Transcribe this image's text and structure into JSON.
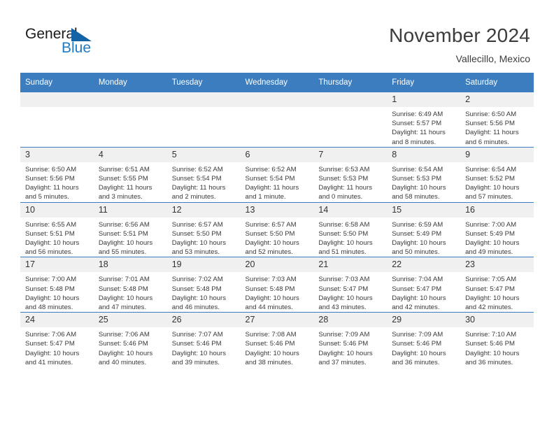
{
  "brand": {
    "name_part1": "General",
    "name_part2": "Blue",
    "accent_color": "#1464a5",
    "blue_text_color": "#1f7ac4"
  },
  "header": {
    "title": "November 2024",
    "subtitle": "Vallecillo, Mexico"
  },
  "calendar": {
    "header_bg": "#3b7dbf",
    "weekdays": [
      "Sunday",
      "Monday",
      "Tuesday",
      "Wednesday",
      "Thursday",
      "Friday",
      "Saturday"
    ],
    "weeks": [
      [
        {
          "day": "",
          "empty": true,
          "sunrise": "",
          "sunset": "",
          "daylight_line1": "",
          "daylight_line2": ""
        },
        {
          "day": "",
          "empty": true,
          "sunrise": "",
          "sunset": "",
          "daylight_line1": "",
          "daylight_line2": ""
        },
        {
          "day": "",
          "empty": true,
          "sunrise": "",
          "sunset": "",
          "daylight_line1": "",
          "daylight_line2": ""
        },
        {
          "day": "",
          "empty": true,
          "sunrise": "",
          "sunset": "",
          "daylight_line1": "",
          "daylight_line2": ""
        },
        {
          "day": "",
          "empty": true,
          "sunrise": "",
          "sunset": "",
          "daylight_line1": "",
          "daylight_line2": ""
        },
        {
          "day": "1",
          "empty": false,
          "sunrise": "Sunrise: 6:49 AM",
          "sunset": "Sunset: 5:57 PM",
          "daylight_line1": "Daylight: 11 hours",
          "daylight_line2": "and 8 minutes."
        },
        {
          "day": "2",
          "empty": false,
          "sunrise": "Sunrise: 6:50 AM",
          "sunset": "Sunset: 5:56 PM",
          "daylight_line1": "Daylight: 11 hours",
          "daylight_line2": "and 6 minutes."
        }
      ],
      [
        {
          "day": "3",
          "empty": false,
          "sunrise": "Sunrise: 6:50 AM",
          "sunset": "Sunset: 5:56 PM",
          "daylight_line1": "Daylight: 11 hours",
          "daylight_line2": "and 5 minutes."
        },
        {
          "day": "4",
          "empty": false,
          "sunrise": "Sunrise: 6:51 AM",
          "sunset": "Sunset: 5:55 PM",
          "daylight_line1": "Daylight: 11 hours",
          "daylight_line2": "and 3 minutes."
        },
        {
          "day": "5",
          "empty": false,
          "sunrise": "Sunrise: 6:52 AM",
          "sunset": "Sunset: 5:54 PM",
          "daylight_line1": "Daylight: 11 hours",
          "daylight_line2": "and 2 minutes."
        },
        {
          "day": "6",
          "empty": false,
          "sunrise": "Sunrise: 6:52 AM",
          "sunset": "Sunset: 5:54 PM",
          "daylight_line1": "Daylight: 11 hours",
          "daylight_line2": "and 1 minute."
        },
        {
          "day": "7",
          "empty": false,
          "sunrise": "Sunrise: 6:53 AM",
          "sunset": "Sunset: 5:53 PM",
          "daylight_line1": "Daylight: 11 hours",
          "daylight_line2": "and 0 minutes."
        },
        {
          "day": "8",
          "empty": false,
          "sunrise": "Sunrise: 6:54 AM",
          "sunset": "Sunset: 5:53 PM",
          "daylight_line1": "Daylight: 10 hours",
          "daylight_line2": "and 58 minutes."
        },
        {
          "day": "9",
          "empty": false,
          "sunrise": "Sunrise: 6:54 AM",
          "sunset": "Sunset: 5:52 PM",
          "daylight_line1": "Daylight: 10 hours",
          "daylight_line2": "and 57 minutes."
        }
      ],
      [
        {
          "day": "10",
          "empty": false,
          "sunrise": "Sunrise: 6:55 AM",
          "sunset": "Sunset: 5:51 PM",
          "daylight_line1": "Daylight: 10 hours",
          "daylight_line2": "and 56 minutes."
        },
        {
          "day": "11",
          "empty": false,
          "sunrise": "Sunrise: 6:56 AM",
          "sunset": "Sunset: 5:51 PM",
          "daylight_line1": "Daylight: 10 hours",
          "daylight_line2": "and 55 minutes."
        },
        {
          "day": "12",
          "empty": false,
          "sunrise": "Sunrise: 6:57 AM",
          "sunset": "Sunset: 5:50 PM",
          "daylight_line1": "Daylight: 10 hours",
          "daylight_line2": "and 53 minutes."
        },
        {
          "day": "13",
          "empty": false,
          "sunrise": "Sunrise: 6:57 AM",
          "sunset": "Sunset: 5:50 PM",
          "daylight_line1": "Daylight: 10 hours",
          "daylight_line2": "and 52 minutes."
        },
        {
          "day": "14",
          "empty": false,
          "sunrise": "Sunrise: 6:58 AM",
          "sunset": "Sunset: 5:50 PM",
          "daylight_line1": "Daylight: 10 hours",
          "daylight_line2": "and 51 minutes."
        },
        {
          "day": "15",
          "empty": false,
          "sunrise": "Sunrise: 6:59 AM",
          "sunset": "Sunset: 5:49 PM",
          "daylight_line1": "Daylight: 10 hours",
          "daylight_line2": "and 50 minutes."
        },
        {
          "day": "16",
          "empty": false,
          "sunrise": "Sunrise: 7:00 AM",
          "sunset": "Sunset: 5:49 PM",
          "daylight_line1": "Daylight: 10 hours",
          "daylight_line2": "and 49 minutes."
        }
      ],
      [
        {
          "day": "17",
          "empty": false,
          "sunrise": "Sunrise: 7:00 AM",
          "sunset": "Sunset: 5:48 PM",
          "daylight_line1": "Daylight: 10 hours",
          "daylight_line2": "and 48 minutes."
        },
        {
          "day": "18",
          "empty": false,
          "sunrise": "Sunrise: 7:01 AM",
          "sunset": "Sunset: 5:48 PM",
          "daylight_line1": "Daylight: 10 hours",
          "daylight_line2": "and 47 minutes."
        },
        {
          "day": "19",
          "empty": false,
          "sunrise": "Sunrise: 7:02 AM",
          "sunset": "Sunset: 5:48 PM",
          "daylight_line1": "Daylight: 10 hours",
          "daylight_line2": "and 46 minutes."
        },
        {
          "day": "20",
          "empty": false,
          "sunrise": "Sunrise: 7:03 AM",
          "sunset": "Sunset: 5:48 PM",
          "daylight_line1": "Daylight: 10 hours",
          "daylight_line2": "and 44 minutes."
        },
        {
          "day": "21",
          "empty": false,
          "sunrise": "Sunrise: 7:03 AM",
          "sunset": "Sunset: 5:47 PM",
          "daylight_line1": "Daylight: 10 hours",
          "daylight_line2": "and 43 minutes."
        },
        {
          "day": "22",
          "empty": false,
          "sunrise": "Sunrise: 7:04 AM",
          "sunset": "Sunset: 5:47 PM",
          "daylight_line1": "Daylight: 10 hours",
          "daylight_line2": "and 42 minutes."
        },
        {
          "day": "23",
          "empty": false,
          "sunrise": "Sunrise: 7:05 AM",
          "sunset": "Sunset: 5:47 PM",
          "daylight_line1": "Daylight: 10 hours",
          "daylight_line2": "and 42 minutes."
        }
      ],
      [
        {
          "day": "24",
          "empty": false,
          "sunrise": "Sunrise: 7:06 AM",
          "sunset": "Sunset: 5:47 PM",
          "daylight_line1": "Daylight: 10 hours",
          "daylight_line2": "and 41 minutes."
        },
        {
          "day": "25",
          "empty": false,
          "sunrise": "Sunrise: 7:06 AM",
          "sunset": "Sunset: 5:46 PM",
          "daylight_line1": "Daylight: 10 hours",
          "daylight_line2": "and 40 minutes."
        },
        {
          "day": "26",
          "empty": false,
          "sunrise": "Sunrise: 7:07 AM",
          "sunset": "Sunset: 5:46 PM",
          "daylight_line1": "Daylight: 10 hours",
          "daylight_line2": "and 39 minutes."
        },
        {
          "day": "27",
          "empty": false,
          "sunrise": "Sunrise: 7:08 AM",
          "sunset": "Sunset: 5:46 PM",
          "daylight_line1": "Daylight: 10 hours",
          "daylight_line2": "and 38 minutes."
        },
        {
          "day": "28",
          "empty": false,
          "sunrise": "Sunrise: 7:09 AM",
          "sunset": "Sunset: 5:46 PM",
          "daylight_line1": "Daylight: 10 hours",
          "daylight_line2": "and 37 minutes."
        },
        {
          "day": "29",
          "empty": false,
          "sunrise": "Sunrise: 7:09 AM",
          "sunset": "Sunset: 5:46 PM",
          "daylight_line1": "Daylight: 10 hours",
          "daylight_line2": "and 36 minutes."
        },
        {
          "day": "30",
          "empty": false,
          "sunrise": "Sunrise: 7:10 AM",
          "sunset": "Sunset: 5:46 PM",
          "daylight_line1": "Daylight: 10 hours",
          "daylight_line2": "and 36 minutes."
        }
      ]
    ]
  }
}
